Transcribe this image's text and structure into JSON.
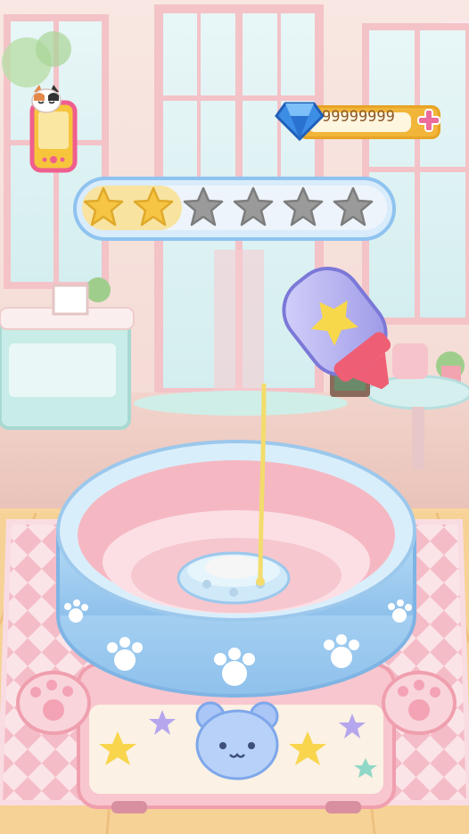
{
  "hud": {
    "gems": {
      "count": "99999999",
      "icon": "diamond-icon",
      "add_icon": "plus-icon"
    },
    "phone": {
      "icon": "phone-icon",
      "mascot": "cat-icon"
    }
  },
  "progress": {
    "stars_filled": 2,
    "stars_total": 6
  },
  "colors": {
    "gem_bar": "#f1b53a",
    "star_filled": "#f6c543",
    "star_empty": "#9a9a9a",
    "panel_border": "#8fc3f0",
    "plus": "#ec6c9b"
  },
  "scene": {
    "syrup_bottle_icon": "syrup-bottle-icon",
    "machine_icon": "cotton-candy-machine",
    "bear_icon": "bear-face-icon",
    "paw_icon": "paw-icon"
  }
}
